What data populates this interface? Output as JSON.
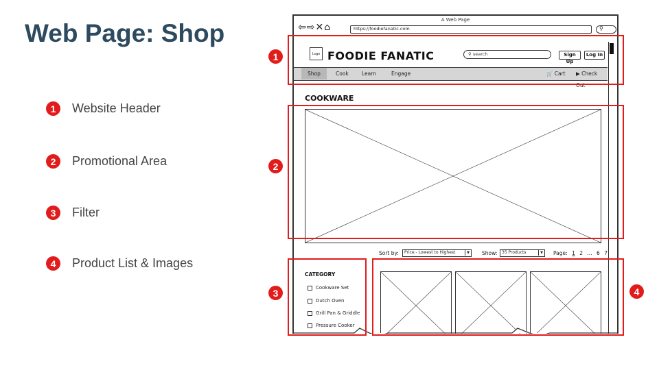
{
  "slide": {
    "title": "Web Page: Shop",
    "legend": [
      {
        "num": "1",
        "label": "Website Header"
      },
      {
        "num": "2",
        "label": "Promotional Area"
      },
      {
        "num": "3",
        "label": "Filter"
      },
      {
        "num": "4",
        "label": "Product List & Images"
      }
    ],
    "accent_color": "#e21b1b",
    "title_color": "#2e4a5f"
  },
  "browser": {
    "window_title": "A Web Page",
    "url": "https://foodiefanatic.com",
    "url_search_icon": "search-icon",
    "nav_icons": [
      "back-arrow-icon",
      "forward-arrow-icon",
      "stop-icon",
      "home-icon"
    ]
  },
  "site": {
    "logo_label": "Logo",
    "name": "FOODIE FANATIC",
    "search_placeholder": "search",
    "signup_label": "Sign Up",
    "login_label": "Log In",
    "nav": [
      {
        "label": "Shop",
        "active": true
      },
      {
        "label": "Cook",
        "active": false
      },
      {
        "label": "Learn",
        "active": false
      },
      {
        "label": "Engage",
        "active": false
      }
    ],
    "cart_label": "Cart",
    "checkout_label": "Check Out"
  },
  "page": {
    "section_title": "COOKWARE",
    "sort_label": "Sort by:",
    "sort_value": "Price - Lowest to Highest",
    "show_label": "Show:",
    "show_value": "35 Products",
    "page_label": "Page:",
    "pages": [
      "1",
      "2",
      "...",
      "6",
      "7"
    ],
    "current_page": "1",
    "category_title": "CATEGORY",
    "categories": [
      "Cookware Set",
      "Dutch Oven",
      "Grill Pan & Griddle",
      "Pressure Cooker"
    ]
  }
}
